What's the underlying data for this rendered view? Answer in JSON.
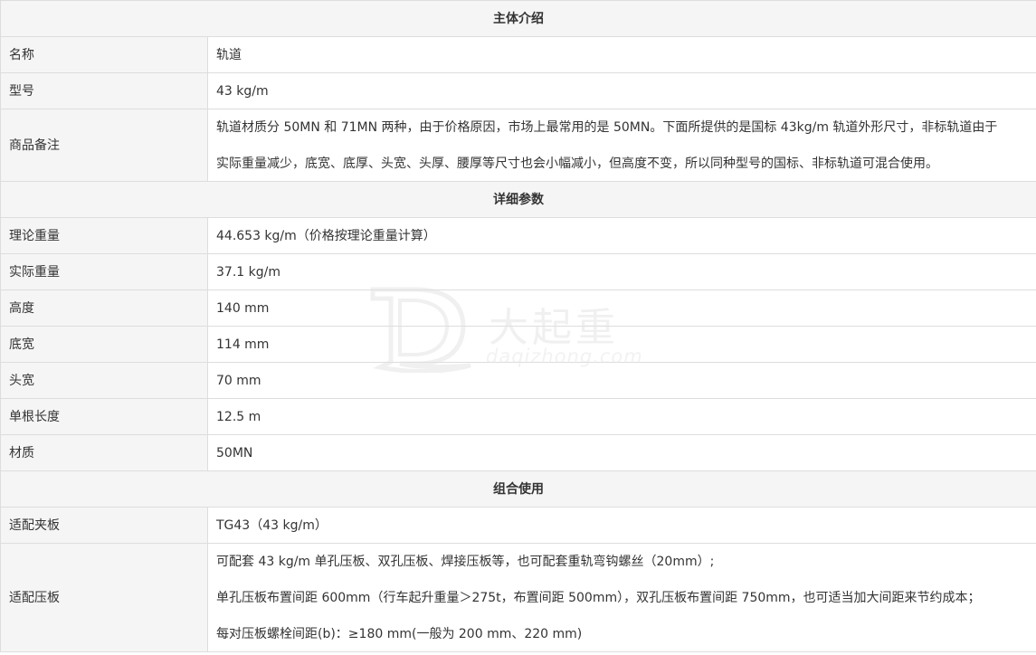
{
  "sections": {
    "intro_title": "主体介绍",
    "detail_title": "详细参数",
    "combo_title": "组合使用"
  },
  "intro": {
    "name": {
      "label": "名称",
      "value": "轨道"
    },
    "model": {
      "label": "型号",
      "value": "43 kg/m"
    },
    "remark": {
      "label": "商品备注",
      "line1": "轨道材质分 50MN 和 71MN 两种，由于价格原因，市场上最常用的是 50MN。下面所提供的是国标 43kg/m 轨道外形尺寸，非标轨道由于",
      "line2": "实际重量减少，底宽、底厚、头宽、头厚、腰厚等尺寸也会小幅减小，但高度不变，所以同种型号的国标、非标轨道可混合使用。"
    }
  },
  "details": {
    "theory_weight": {
      "label": "理论重量",
      "value": "44.653 kg/m（价格按理论重量计算）"
    },
    "actual_weight": {
      "label": "实际重量",
      "value": "37.1 kg/m"
    },
    "height": {
      "label": "高度",
      "value": "140 mm"
    },
    "bottom_width": {
      "label": "底宽",
      "value": "114 mm"
    },
    "head_width": {
      "label": "头宽",
      "value": "70 mm"
    },
    "length": {
      "label": "单根长度",
      "value": "12.5 m"
    },
    "material": {
      "label": "材质",
      "value": "50MN"
    }
  },
  "combo": {
    "clamp": {
      "label": "适配夹板",
      "value": "TG43（43 kg/m）"
    },
    "plate": {
      "label": "适配压板",
      "line1": "可配套 43 kg/m 单孔压板、双孔压板、焊接压板等，也可配套重轨弯钩螺丝（20mm）;",
      "line2": "单孔压板布置间距 600mm（行车起升重量＞275t，布置间距 500mm），双孔压板布置间距 750mm，也可适当加大间距来节约成本；",
      "line3": "每对压板螺栓间距(b)：≥180 mm(一般为 200 mm、220 mm)"
    }
  },
  "watermark": {
    "brand": "大起重",
    "url": "daqizhong.com"
  }
}
